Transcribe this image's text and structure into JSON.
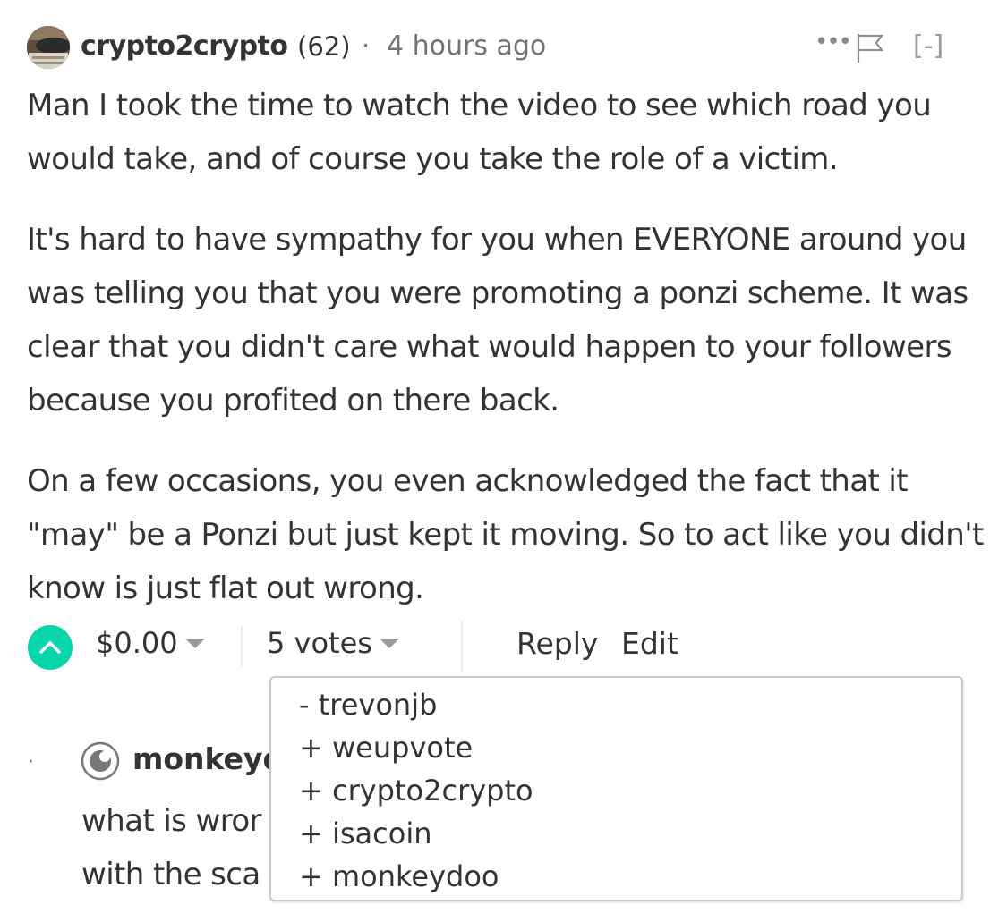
{
  "comment": {
    "author": "crypto2crypto",
    "reputation": "(62)",
    "separator": "·",
    "timestamp": "4 hours ago",
    "more_icon": "more-dots-icon",
    "flag_icon": "flag-icon",
    "collapse_label": "[-]",
    "paragraphs": [
      "Man I took the time to watch the video to see which road you would take, and of course you take the role of a victim.",
      "It's hard to have sympathy for you when EVERYONE around you was telling you that you were promoting a ponzi scheme. It was clear that you didn't care what would happen to your followers because you profited on there back.",
      "On a few occasions, you even acknowledged the fact that it \"may\" be a Ponzi but just kept it moving. So to act like you didn't know is just flat out wrong."
    ],
    "footer": {
      "upvote_icon": "upvote-chevron-icon",
      "payout": "$0.00",
      "votes": "5 votes",
      "reply_label": "Reply",
      "edit_label": "Edit"
    }
  },
  "voters": [
    "- trevonjb",
    "+ weupvote",
    "+ crypto2crypto",
    "+ isacoin",
    "+ monkeydoo"
  ],
  "reply": {
    "bullet": "·",
    "author_visible": "monkeyd",
    "lines_visible": [
      "what is wror",
      "with the sca"
    ]
  },
  "colors": {
    "accent": "#06d6a9",
    "text": "#333333",
    "muted": "#6f7377",
    "border": "#c9c9c9"
  }
}
